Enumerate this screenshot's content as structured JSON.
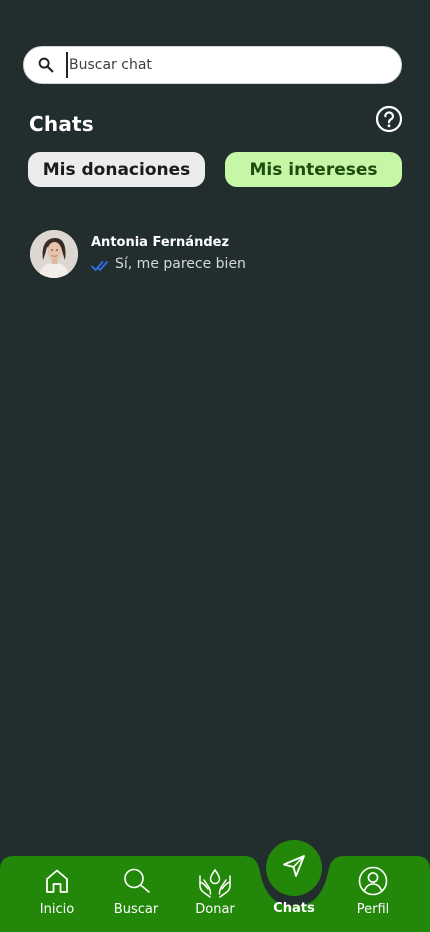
{
  "search": {
    "placeholder": "Buscar chat",
    "value": ""
  },
  "header": {
    "title": "Chats"
  },
  "tabs": [
    {
      "label": "Mis donaciones",
      "active": false
    },
    {
      "label": "Mis intereses",
      "active": true
    }
  ],
  "chats": [
    {
      "name": "Antonia Fernández",
      "last_message": "Sí, me parece bien",
      "read_status": "double-check-icon"
    }
  ],
  "nav": {
    "items": [
      {
        "label": "Inicio",
        "icon": "home-icon"
      },
      {
        "label": "Buscar",
        "icon": "search-icon"
      },
      {
        "label": "Donar",
        "icon": "donate-hands-icon"
      },
      {
        "label": "Chats",
        "icon": "paper-plane-icon",
        "active": true
      },
      {
        "label": "Perfil",
        "icon": "profile-icon"
      }
    ]
  },
  "colors": {
    "background": "#222d2e",
    "nav": "#23880a",
    "tab_active": "#c6f7a6",
    "tab_inactive": "#ececec",
    "read_ticks": "#2f6fe8"
  }
}
